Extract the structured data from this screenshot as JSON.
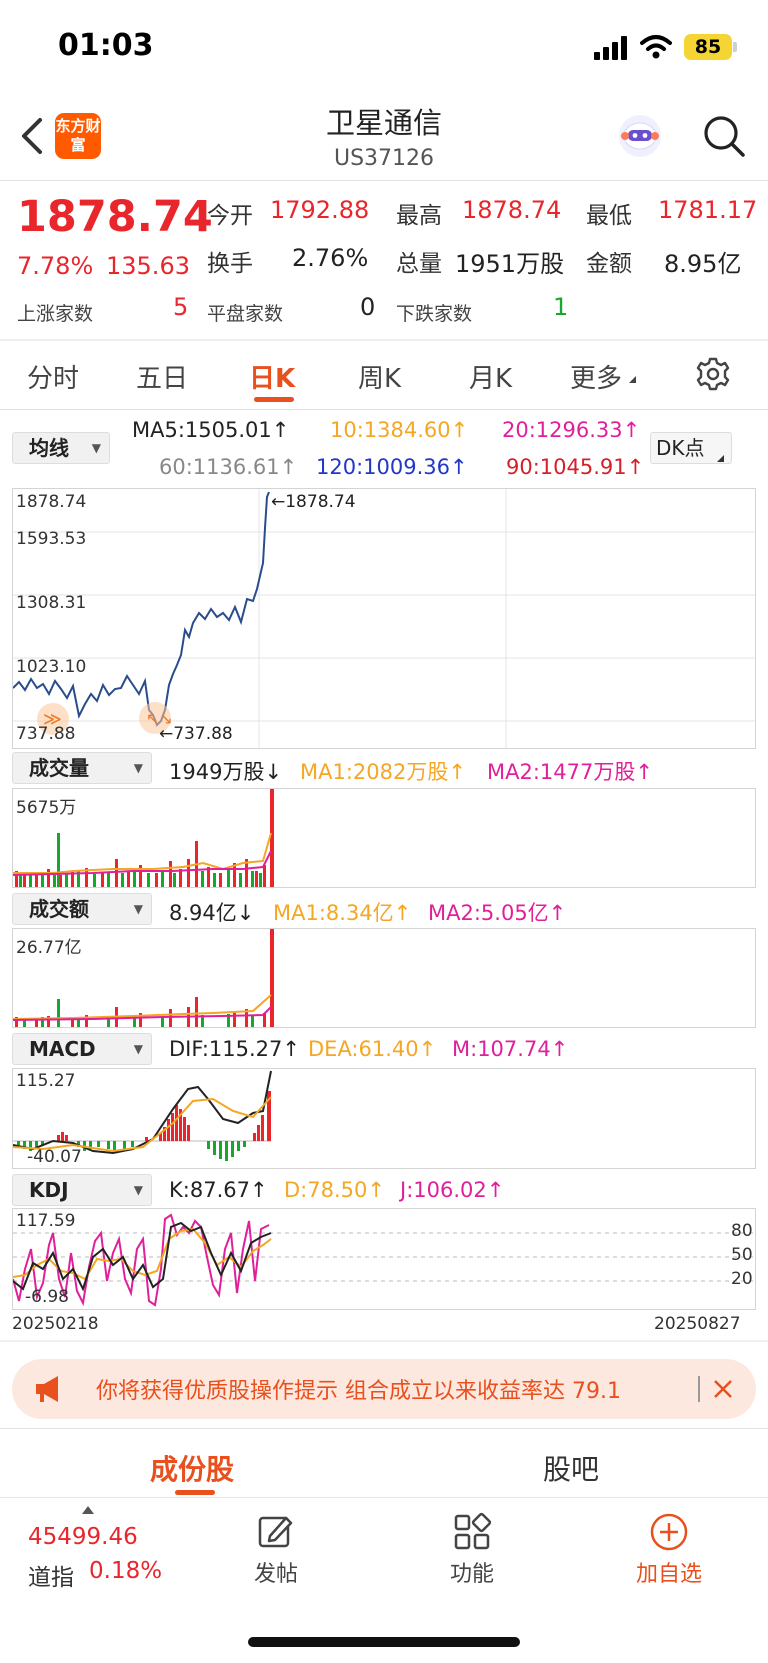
{
  "status": {
    "time": "01:03",
    "battery": "85"
  },
  "header": {
    "title": "卫星通信",
    "code": "US37126",
    "logo_text": "东方财富"
  },
  "quote": {
    "price": "1878.74",
    "change_pct": "7.78%",
    "change": "135.63",
    "open_label": "今开",
    "open": "1792.88",
    "high_label": "最高",
    "high": "1878.74",
    "low_label": "最低",
    "low": "1781.17",
    "turnover_label": "换手",
    "turnover": "2.76%",
    "volume_label": "总量",
    "volume": "1951万股",
    "amount_label": "金额",
    "amount": "8.95亿",
    "up_label": "上涨家数",
    "up": "5",
    "flat_label": "平盘家数",
    "flat": "0",
    "down_label": "下跌家数",
    "down": "1"
  },
  "tabs": {
    "t1": "分时",
    "t2": "五日",
    "t3": "日K",
    "t4": "周K",
    "t5": "月K",
    "t6": "更多"
  },
  "ma": {
    "selector": "均线",
    "ma5": "MA5:1505.01↑",
    "ma10": "10:1384.60↑",
    "ma20": "20:1296.33↑",
    "ma60": "60:1136.61↑",
    "ma120": "120:1009.36↑",
    "ma90": "90:1045.91↑",
    "dk": "DK点",
    "colors": {
      "ma5": "#222222",
      "ma10": "#f5a623",
      "ma20": "#e0209a",
      "ma60": "#888888",
      "ma120": "#2236c8",
      "ma90": "#d4202a"
    }
  },
  "kline": {
    "y_ticks": [
      "1878.74",
      "1593.53",
      "1308.31",
      "1023.10",
      "737.88"
    ],
    "max_marker": "←1878.74",
    "min_marker": "←737.88",
    "line_color": "#2a4c8c"
  },
  "volume": {
    "selector": "成交量",
    "value": "1949万股↓",
    "ma1": "MA1:2082万股↑",
    "ma2": "MA2:1477万股↑",
    "top_label": "5675万"
  },
  "amount": {
    "selector": "成交额",
    "value": "8.94亿↓",
    "ma1": "MA1:8.34亿↑",
    "ma2": "MA2:5.05亿↑",
    "top_label": "26.77亿"
  },
  "macd": {
    "selector": "MACD",
    "dif": "DIF:115.27↑",
    "dea": "DEA:61.40↑",
    "m": "M:107.74↑",
    "top_label": "115.27",
    "bottom_label": "-40.07"
  },
  "kdj": {
    "selector": "KDJ",
    "k": "K:87.67↑",
    "d": "D:78.50↑",
    "j": "J:106.02↑",
    "top_label": "117.59",
    "bottom_label": "-6.98",
    "levels": [
      "80",
      "50",
      "20"
    ]
  },
  "dates": {
    "start": "20250218",
    "end": "20250827"
  },
  "banner": {
    "text": "你将获得优质股操作提示 组合成立以来收益率达 79.1"
  },
  "bottom_tabs": {
    "left": "成份股",
    "right": "股吧"
  },
  "nav": {
    "index_value": "45499.46",
    "index_name": "道指",
    "index_change": "0.18%",
    "post": "发帖",
    "func": "功能",
    "add": "加自选"
  }
}
